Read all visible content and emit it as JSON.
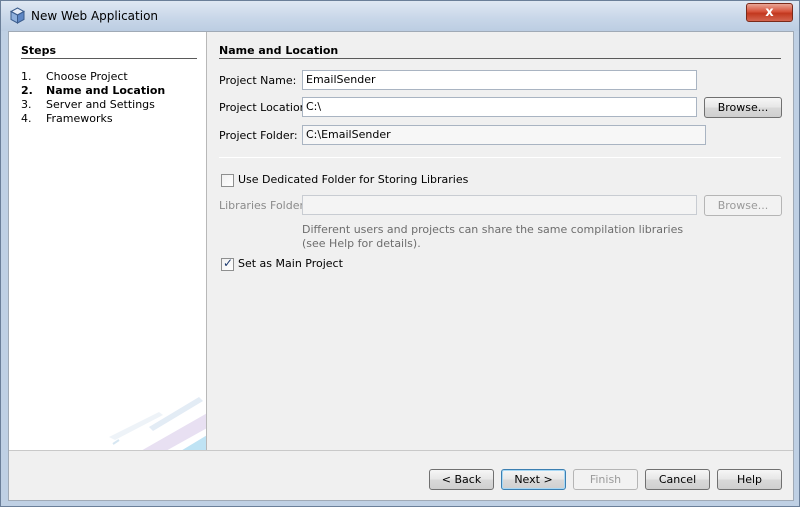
{
  "window": {
    "title": "New Web Application",
    "close_glyph": "x"
  },
  "steps": {
    "heading": "Steps",
    "items": [
      {
        "num": "1.",
        "label": "Choose Project"
      },
      {
        "num": "2.",
        "label": "Name and Location"
      },
      {
        "num": "3.",
        "label": "Server and Settings"
      },
      {
        "num": "4.",
        "label": "Frameworks"
      }
    ],
    "current_index": 1
  },
  "form": {
    "heading": "Name and Location",
    "project_name_label": "Project Name:",
    "project_name_value": "EmailSender",
    "project_location_label": "Project Location:",
    "project_location_value": "C:\\",
    "browse_label": "Browse...",
    "project_folder_label": "Project Folder:",
    "project_folder_value": "C:\\EmailSender",
    "dedicated_folder_label": "Use Dedicated Folder for Storing Libraries",
    "dedicated_folder_checked": false,
    "libraries_folder_label": "Libraries Folder:",
    "libraries_folder_value": "",
    "libraries_browse_label": "Browse...",
    "hint_text": "Different users and projects can share the same compilation libraries (see Help for details).",
    "main_project_label": "Set as Main Project",
    "main_project_checked": true
  },
  "buttons": {
    "back": "< Back",
    "next": "Next >",
    "finish": "Finish",
    "cancel": "Cancel",
    "help": "Help"
  },
  "colors": {
    "title_bar": "#c7d6e8",
    "close_button": "#c2381f",
    "default_button_border": "#3c7fb1"
  }
}
